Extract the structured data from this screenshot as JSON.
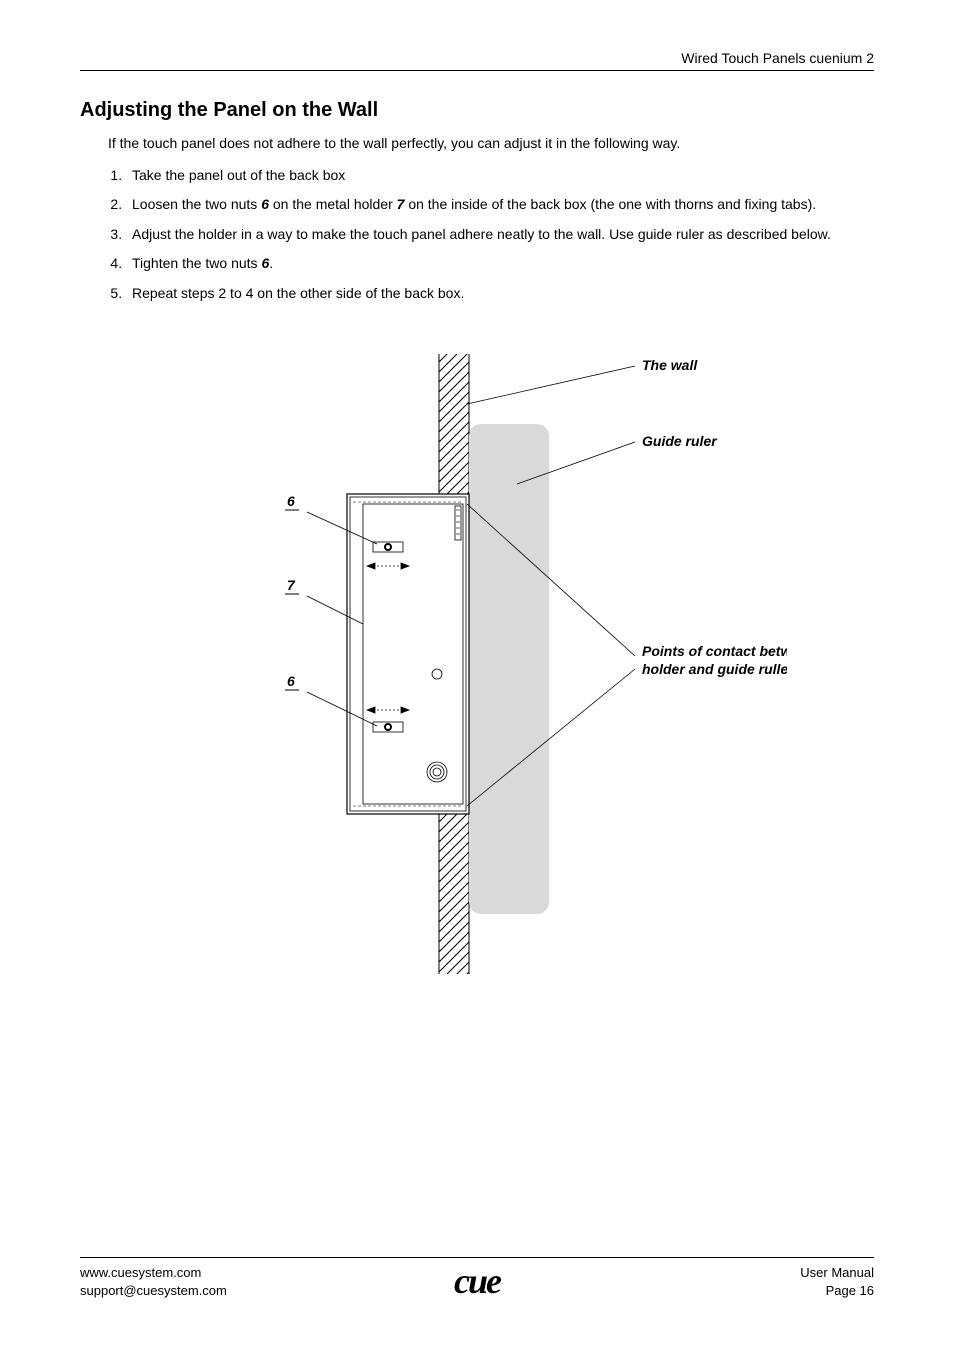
{
  "header": {
    "title": "Wired Touch Panels cuenium 2"
  },
  "section": {
    "heading": "Adjusting the Panel on the Wall",
    "intro": "If the touch panel does not adhere to the wall perfectly, you can adjust it in the following way.",
    "steps": {
      "s1": "Take the panel out of the back box",
      "s2a": "Loosen the two nuts ",
      "s2b": " on the metal holder ",
      "s2c": " on the inside of the back box (the one with thorns and fixing tabs).",
      "s3": "Adjust the holder in a way to make the touch panel adhere neatly to the wall. Use guide ruler as described below.",
      "s4a": "Tighten the two nuts ",
      "s4b": ".",
      "s5": "Repeat steps 2 to 4 on the other side of the back box."
    },
    "refs": {
      "six": "6",
      "seven": "7"
    }
  },
  "figure": {
    "label_wall": "The wall",
    "label_ruler": "Guide ruler",
    "label_contact_l1": "Points of contact between",
    "label_contact_l2": "holder and guide ruller",
    "label_6": "6",
    "label_7": "7"
  },
  "footer": {
    "url": "www.cuesystem.com",
    "email": "support@cuesystem.com",
    "logo": "cue",
    "manual": "User Manual",
    "page": "Page 16"
  }
}
